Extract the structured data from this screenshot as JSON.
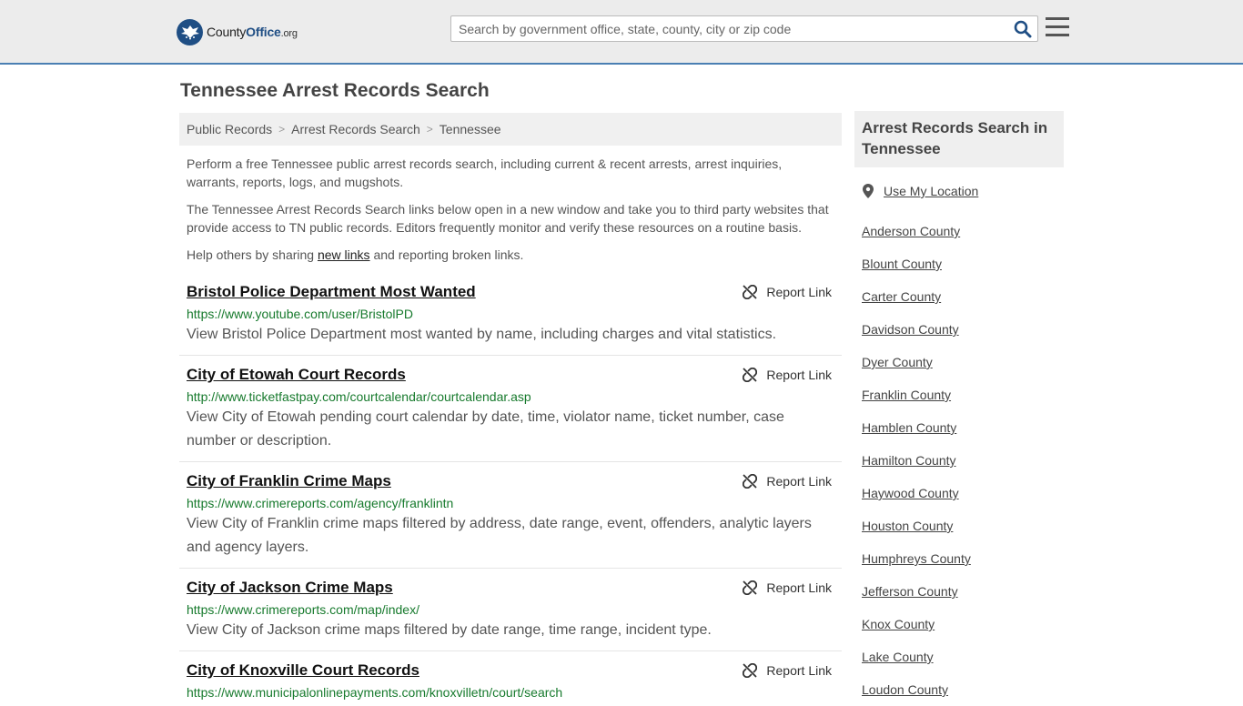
{
  "header": {
    "logo": {
      "brand_a": "County",
      "brand_b": "Office",
      "brand_c": ".org"
    },
    "search_placeholder": "Search by government office, state, county, city or zip code"
  },
  "page": {
    "title": "Tennessee Arrest Records Search",
    "breadcrumb": [
      "Public Records",
      "Arrest Records Search",
      "Tennessee"
    ],
    "intro_1": "Perform a free Tennessee public arrest records search, including current & recent arrests, arrest inquiries, warrants, reports, logs, and mugshots.",
    "intro_2": "The Tennessee Arrest Records Search links below open in a new window and take you to third party websites that provide access to TN public records. Editors frequently monitor and verify these resources on a routine basis.",
    "intro_3_a": "Help others by sharing ",
    "intro_3_link": "new links",
    "intro_3_b": " and reporting broken links."
  },
  "report_label": "Report Link",
  "results": [
    {
      "title": "Bristol Police Department Most Wanted",
      "url": "https://www.youtube.com/user/BristolPD",
      "desc": "View Bristol Police Department most wanted by name, including charges and vital statistics."
    },
    {
      "title": "City of Etowah Court Records",
      "url": "http://www.ticketfastpay.com/courtcalendar/courtcalendar.asp",
      "desc": "View City of Etowah pending court calendar by date, time, violator name, ticket number, case number or description."
    },
    {
      "title": "City of Franklin Crime Maps",
      "url": "https://www.crimereports.com/agency/franklintn",
      "desc": "View City of Franklin crime maps filtered by address, date range, event, offenders, analytic layers and agency layers."
    },
    {
      "title": "City of Jackson Crime Maps",
      "url": "https://www.crimereports.com/map/index/",
      "desc": "View City of Jackson crime maps filtered by date range, time range, incident type."
    },
    {
      "title": "City of Knoxville Court Records",
      "url": "https://www.municipalonlinepayments.com/knoxvilletn/court/search",
      "desc": ""
    }
  ],
  "sidebar": {
    "heading": "Arrest Records Search in Tennessee",
    "use_location": "Use My Location",
    "counties": [
      "Anderson County",
      "Blount County",
      "Carter County",
      "Davidson County",
      "Dyer County",
      "Franklin County",
      "Hamblen County",
      "Hamilton County",
      "Haywood County",
      "Houston County",
      "Humphreys County",
      "Jefferson County",
      "Knox County",
      "Lake County",
      "Loudon County"
    ]
  },
  "colors": {
    "brand_blue": "#1f4e84",
    "url_green": "#177a2d",
    "header_border": "#4a7fb3"
  }
}
